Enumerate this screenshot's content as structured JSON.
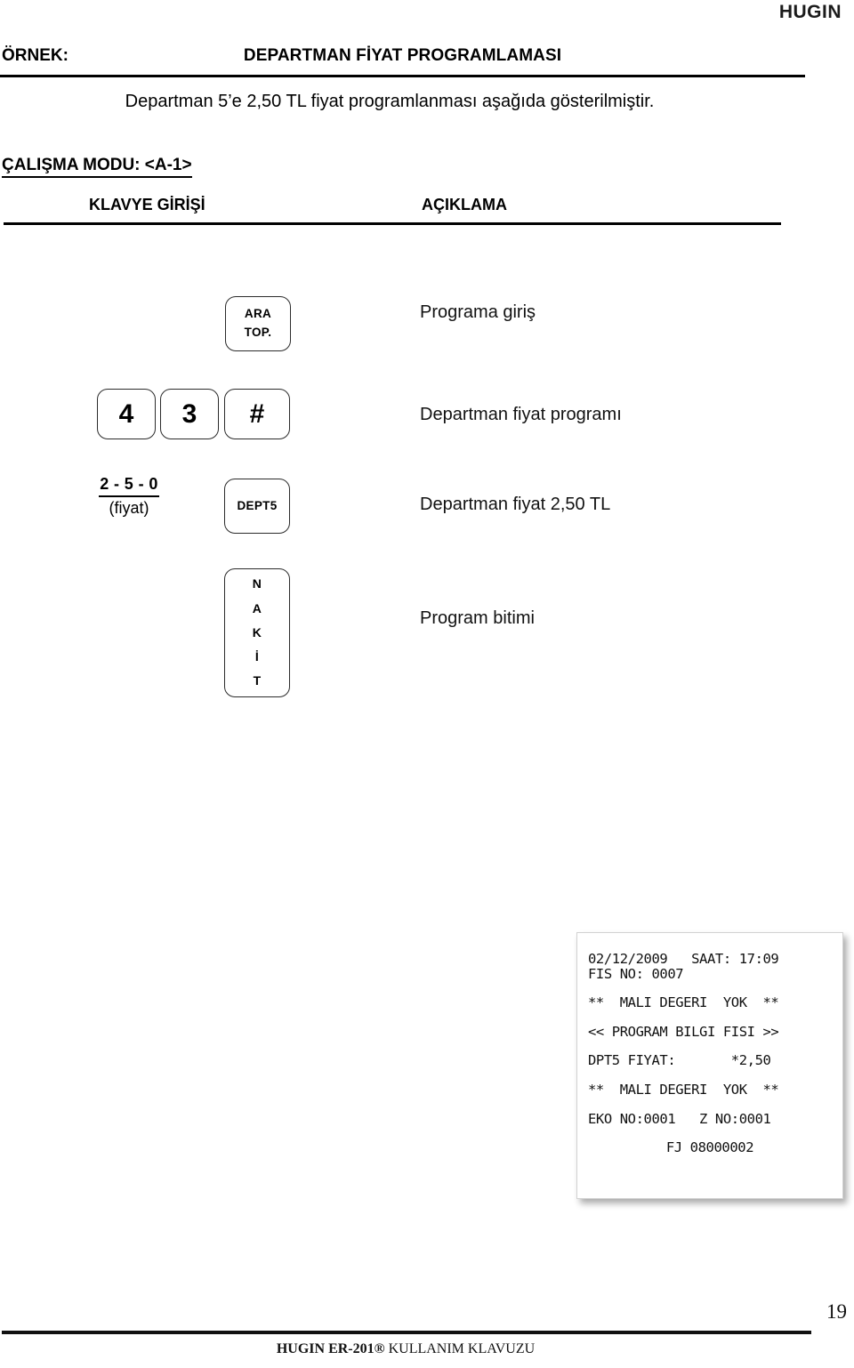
{
  "brand": {
    "logo": "HUGIN"
  },
  "header": {
    "example_label": "ÖRNEK:",
    "title": "DEPARTMAN FİYAT PROGRAMLAMASI",
    "subtitle": "Departman 5’e 2,50 TL fiyat programlanması aşağıda gösterilmiştir.",
    "mode_line": "ÇALIŞMA MODU: <A-1>"
  },
  "columns": {
    "keyboard_entry": "KLAVYE GİRİŞİ",
    "description": "AÇIKLAMA"
  },
  "steps": [
    {
      "keys": [
        {
          "name": "ara-top",
          "lines": [
            "ARA",
            "TOP."
          ]
        }
      ],
      "description": "Programa giriş"
    },
    {
      "keys": [
        {
          "name": "four",
          "lines": [
            "4"
          ]
        },
        {
          "name": "three",
          "lines": [
            "3"
          ]
        },
        {
          "name": "hash",
          "lines": [
            "#"
          ]
        }
      ],
      "description": "Departman  fiyat programı"
    },
    {
      "price_digits": "2 - 5 - 0",
      "price_label": "(fiyat)",
      "keys": [
        {
          "name": "dept5",
          "lines": [
            "DEPT5"
          ]
        }
      ],
      "description": "Departman  fiyat 2,50 TL"
    },
    {
      "keys": [
        {
          "name": "nakit",
          "lines": [
            "N",
            "A",
            "K",
            "İ",
            "T"
          ]
        }
      ],
      "description": "Program bitimi"
    }
  ],
  "receipt": {
    "lines": [
      "02/12/2009   SAAT: 17:09",
      "FIS NO: 0007",
      "**  MALI DEGERI  YOK  **",
      "<< PROGRAM BILGI FISI >>",
      "DPT5 FIYAT:       *2,50",
      "**  MALI DEGERI  YOK  **",
      "EKO NO:0001   Z NO:0001",
      "FJ 08000002"
    ],
    "date": "02/12/2009",
    "time_label": "SAAT:",
    "time": "17:09",
    "receipt_no_label": "FIS NO:",
    "receipt_no": "0007",
    "fiscal_note": "**  MALI DEGERI  YOK  **",
    "program_header": "<< PROGRAM BILGI FISI >>",
    "dept_price_label": "DPT5 FIYAT:",
    "dept_price_value": "*2,50",
    "eko_no": "EKO NO:0001",
    "z_no": "Z NO:0001",
    "fj_no": "FJ 08000002"
  },
  "footer": {
    "page_number": "19",
    "model": "HUGIN ER-201®",
    "manual": "KULLANIM KLAVUZU"
  }
}
